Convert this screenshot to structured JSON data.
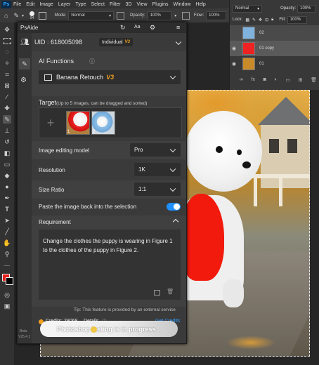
{
  "menubar": {
    "app_icon": "Ps",
    "items": [
      "File",
      "Edit",
      "Image",
      "Layer",
      "Type",
      "Select",
      "Filter",
      "3D",
      "View",
      "Plugins",
      "Window",
      "Help"
    ]
  },
  "optionsbar": {
    "brush_size": "94",
    "mode_label": "Mode:",
    "mode_value": "Normal",
    "opacity_label": "Opacity:",
    "opacity_value": "100%",
    "flow_label": "Flow:",
    "flow_value": "100%"
  },
  "layers": {
    "blend_mode": "Normal",
    "opacity_label": "Opacity:",
    "opacity_value": "100%",
    "lock_label": "Lock:",
    "fill_label": "Fill:",
    "fill_value": "100%",
    "rows": [
      {
        "name": "02"
      },
      {
        "name": "01 copy"
      },
      {
        "name": "01"
      }
    ]
  },
  "plugin": {
    "title": "PsAide",
    "uid_label": "UID : 618005098",
    "plan_label": "Individual",
    "plan_badge": "V3",
    "ai_functions_label": "AI Functions",
    "function_value": "Banana Retouch",
    "function_badge": "V3",
    "target_label": "Target",
    "target_hint": "(Up to 5 images, can be dragged and sorted)",
    "target_thumbs": [
      {
        "index": "1"
      },
      {
        "index": "2"
      }
    ],
    "model_label": "Image editing model",
    "model_value": "Pro",
    "resolution_label": "Resolution",
    "resolution_value": "1K",
    "ratio_label": "Size Ratio",
    "ratio_value": "1:1",
    "paste_label": "Paste the image back into the selection",
    "paste_enabled": true,
    "requirement_label": "Requirement",
    "requirement_text": "Change the clothes the puppy is wearing in Figure 1 to the clothes of the puppy in Figure 2.",
    "tip_text": "Tip: This feature is provided by an external service",
    "credits_label": "Credits: 28068",
    "details_label": "Details",
    "get_credits_label": "Get Credits",
    "progress_text": "Photoshop testing is in progress ..",
    "version_label": "Beta",
    "version_number": "V25.4.1"
  },
  "colors": {
    "accent_blue": "#2d9cff",
    "badge_orange": "#f0a020",
    "foreground_swatch": "#e3201b",
    "toggle_on": "#1e90ff"
  }
}
